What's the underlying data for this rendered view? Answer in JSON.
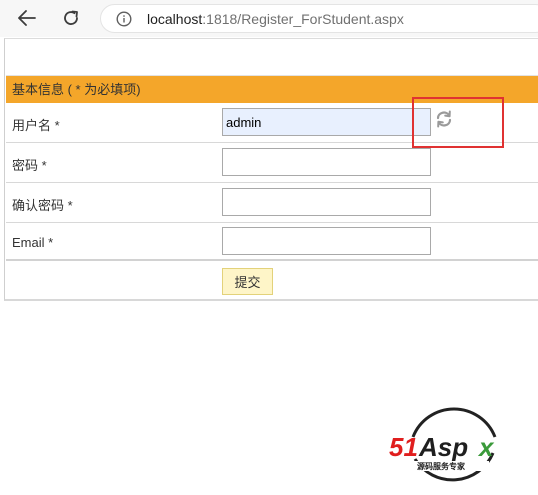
{
  "browser": {
    "url_host": "localhost",
    "url_path": ":1818/Register_ForStudent.aspx"
  },
  "form": {
    "section_title": "基本信息 ( * 为必填项)",
    "username_label": "用户名 *",
    "username_value": "admin",
    "password_label": "密码 *",
    "confirm_password_label": "确认密码 *",
    "email_label": "Email *",
    "submit_label": "提交"
  },
  "watermark": {
    "brand": "51Aspx",
    "tagline": "源码服务专家"
  },
  "colors": {
    "header": "#f4a62a",
    "highlight": "#e03232",
    "autofill": "#e8f0fe",
    "submit_bg": "#fef5c8"
  },
  "icons": [
    "back-arrow-icon",
    "reload-icon",
    "info-icon",
    "refresh-icon"
  ]
}
